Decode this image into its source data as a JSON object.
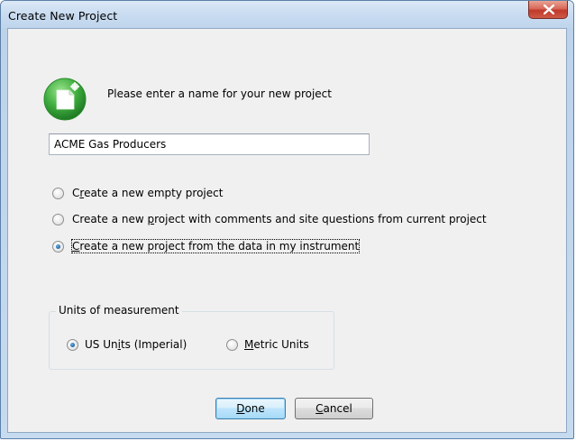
{
  "window": {
    "title": "Create New Project",
    "close_icon": "close-x-icon"
  },
  "header": {
    "icon": "new-project-icon",
    "prompt": "Please enter a name for your new project"
  },
  "project_name": {
    "value": "ACME Gas Producers",
    "placeholder": ""
  },
  "create_options": [
    {
      "pre": "C",
      "key": "r",
      "post": "eate a new empty project",
      "selected": false,
      "focused": false
    },
    {
      "pre": "Create a new ",
      "key": "p",
      "post": "roject with comments and site questions from current project",
      "selected": false,
      "focused": false
    },
    {
      "pre": "",
      "key": "C",
      "post": "reate a new project from the data in my instrument",
      "selected": true,
      "focused": true
    }
  ],
  "units": {
    "group_title": "Units of measurement",
    "options": [
      {
        "pre": "US Un",
        "key": "i",
        "post": "ts (Imperial)",
        "selected": true
      },
      {
        "pre": "",
        "key": "M",
        "post": "etric Units",
        "selected": false
      }
    ]
  },
  "buttons": {
    "done": {
      "pre": "",
      "key": "D",
      "post": "one"
    },
    "cancel": {
      "pre": "",
      "key": "C",
      "post": "ancel"
    }
  },
  "colors": {
    "accent": "#1d5e9c",
    "icon_green": "#3fae3f",
    "close_red": "#c0392b"
  }
}
